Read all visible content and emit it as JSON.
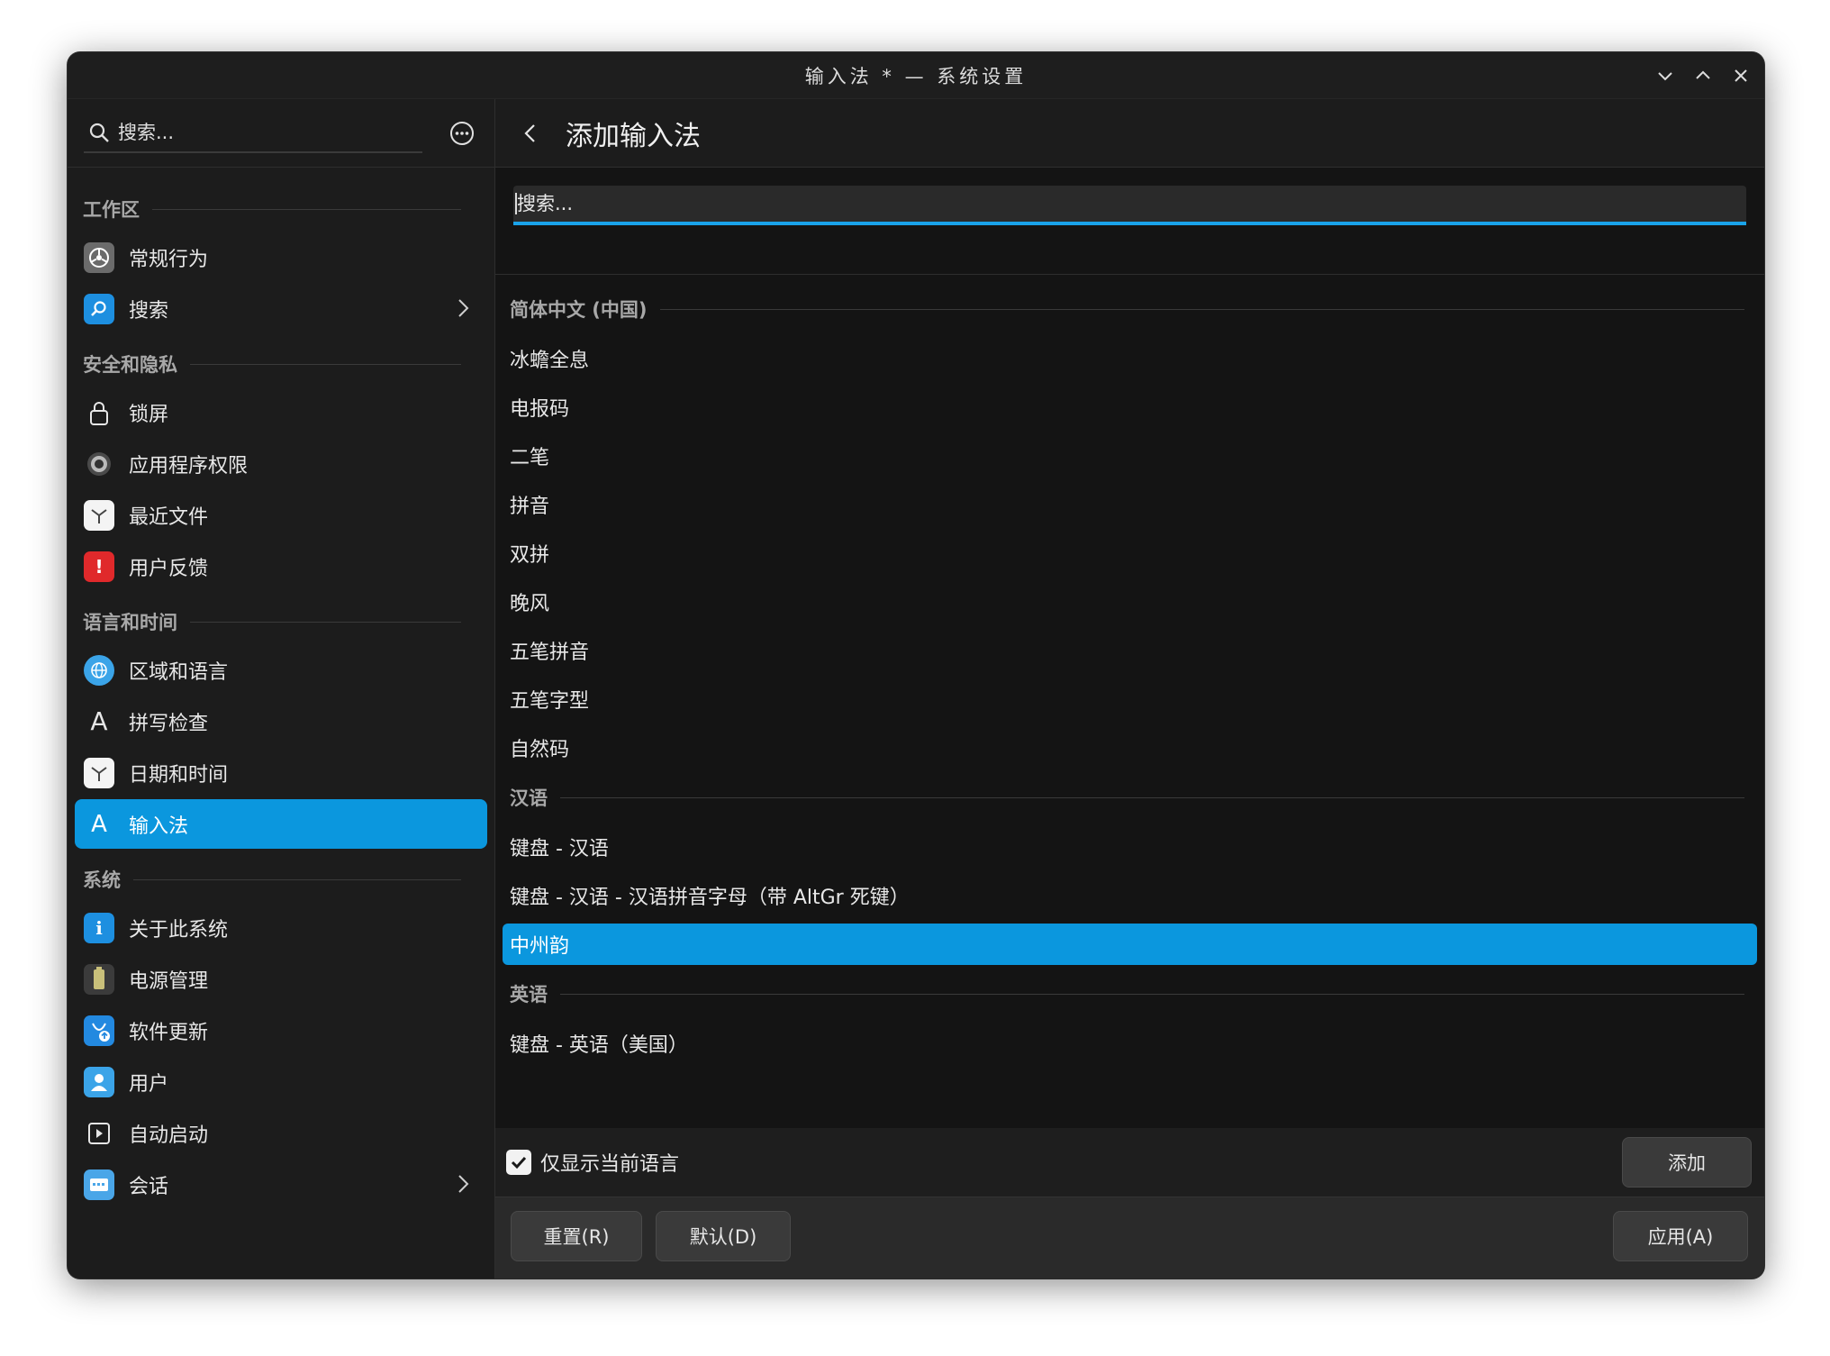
{
  "window": {
    "title": "输入法 * — 系统设置"
  },
  "sidebar": {
    "search_placeholder": "搜索...",
    "sections": [
      {
        "header": "工作区",
        "items": [
          {
            "label": "常规行为",
            "icon": "general-behavior-icon"
          },
          {
            "label": "搜索",
            "icon": "search-icon",
            "has_chevron": true
          }
        ]
      },
      {
        "header": "安全和隐私",
        "items": [
          {
            "label": "锁屏",
            "icon": "lock-icon"
          },
          {
            "label": "应用程序权限",
            "icon": "app-permissions-icon"
          },
          {
            "label": "最近文件",
            "icon": "recent-files-icon"
          },
          {
            "label": "用户反馈",
            "icon": "feedback-icon"
          }
        ]
      },
      {
        "header": "语言和时间",
        "items": [
          {
            "label": "区域和语言",
            "icon": "globe-icon"
          },
          {
            "label": "拼写检查",
            "icon": "spellcheck-icon"
          },
          {
            "label": "日期和时间",
            "icon": "clock-icon"
          },
          {
            "label": "输入法",
            "icon": "input-method-icon",
            "active": true
          }
        ]
      },
      {
        "header": "系统",
        "items": [
          {
            "label": "关于此系统",
            "icon": "info-icon"
          },
          {
            "label": "电源管理",
            "icon": "battery-icon"
          },
          {
            "label": "软件更新",
            "icon": "software-update-icon"
          },
          {
            "label": "用户",
            "icon": "user-icon"
          },
          {
            "label": "自动启动",
            "icon": "autostart-icon"
          },
          {
            "label": "会话",
            "icon": "session-icon",
            "has_chevron": true
          }
        ]
      }
    ]
  },
  "main": {
    "title": "添加输入法",
    "search_placeholder": "搜索...",
    "groups": [
      {
        "header": "简体中文 (中国)",
        "items": [
          "冰蟾全息",
          "电报码",
          "二笔",
          "拼音",
          "双拼",
          "晚风",
          "五笔拼音",
          "五笔字型",
          "自然码"
        ]
      },
      {
        "header": "汉语",
        "items": [
          "键盘 - 汉语",
          "键盘 - 汉语 - 汉语拼音字母（带 AltGr 死键）",
          "中州韵"
        ]
      },
      {
        "header": "英语",
        "items": [
          "键盘 - 英语（美国）"
        ]
      }
    ],
    "selected_item": "中州韵",
    "only_current_language_label": "仅显示当前语言",
    "only_current_language_checked": true,
    "add_button": "添加"
  },
  "footer": {
    "reset_button": "重置(R)",
    "default_button": "默认(D)",
    "apply_button": "应用(A)"
  },
  "colors": {
    "accent": "#0b97de",
    "window_bg": "#141414",
    "sidebar_bg": "#1c1c1c"
  }
}
